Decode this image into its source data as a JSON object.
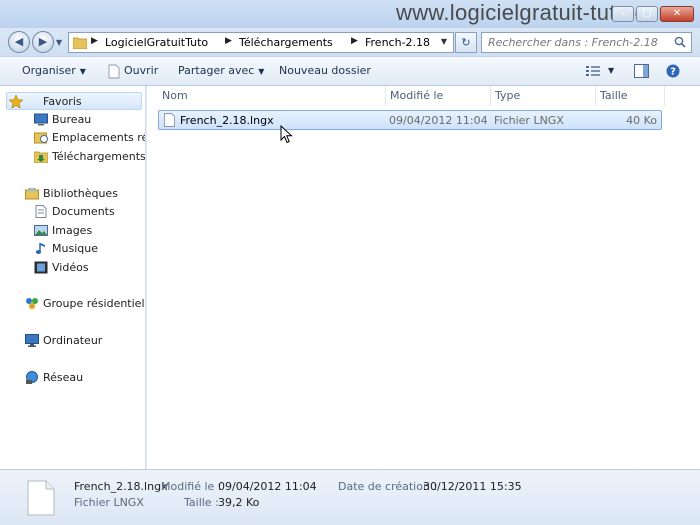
{
  "watermark": "www.logicielgratuit-tuto.com",
  "address": {
    "crumbs": [
      "LogicielGratuitTuto",
      "Téléchargements",
      "French-2.18"
    ]
  },
  "search": {
    "placeholder": "Rechercher dans : French-2.18"
  },
  "toolbar": {
    "organize": "Organiser",
    "open": "Ouvrir",
    "share": "Partager avec",
    "new_folder": "Nouveau dossier"
  },
  "sidebar": {
    "favorites": {
      "label": "Favoris",
      "items": [
        "Bureau",
        "Emplacements récents",
        "Téléchargements"
      ]
    },
    "libraries": {
      "label": "Bibliothèques",
      "items": [
        "Documents",
        "Images",
        "Musique",
        "Vidéos"
      ]
    },
    "homegroup": "Groupe résidentiel",
    "computer": "Ordinateur",
    "network": "Réseau"
  },
  "columns": {
    "name": "Nom",
    "modified": "Modifié le",
    "type": "Type",
    "size": "Taille"
  },
  "files": [
    {
      "name": "French_2.18.lngx",
      "modified": "09/04/2012 11:04",
      "type": "Fichier LNGX",
      "size": "40 Ko"
    }
  ],
  "details": {
    "name": "French_2.18.lngx",
    "type": "Fichier LNGX",
    "modified_label": "Modifié le :",
    "modified_value": "09/04/2012 11:04",
    "size_label": "Taille :",
    "size_value": "39,2 Ko",
    "created_label": "Date de création :",
    "created_value": "30/12/2011 15:35"
  },
  "colors": {
    "selection": "#cde2fb",
    "chrome": "#dbe7f5",
    "favorites_star": "#e8b21a"
  }
}
